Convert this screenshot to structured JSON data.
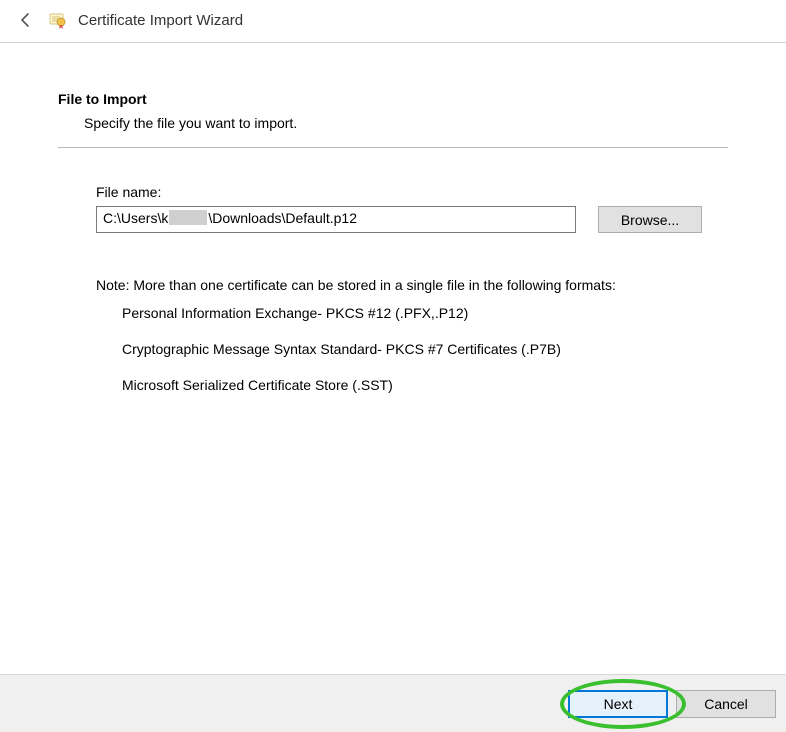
{
  "header": {
    "title": "Certificate Import Wizard"
  },
  "section": {
    "title": "File to Import",
    "subtitle": "Specify the file you want to import."
  },
  "form": {
    "filename_label": "File name:",
    "filename_prefix": "C:\\Users\\k",
    "filename_suffix": "\\Downloads\\Default.p12",
    "browse_label": "Browse..."
  },
  "note": {
    "intro": "Note:  More than one certificate can be stored in a single file in the following formats:",
    "items": [
      "Personal Information Exchange- PKCS #12 (.PFX,.P12)",
      "Cryptographic Message Syntax Standard- PKCS #7 Certificates (.P7B)",
      "Microsoft Serialized Certificate Store (.SST)"
    ]
  },
  "footer": {
    "next_label": "Next",
    "cancel_label": "Cancel"
  }
}
